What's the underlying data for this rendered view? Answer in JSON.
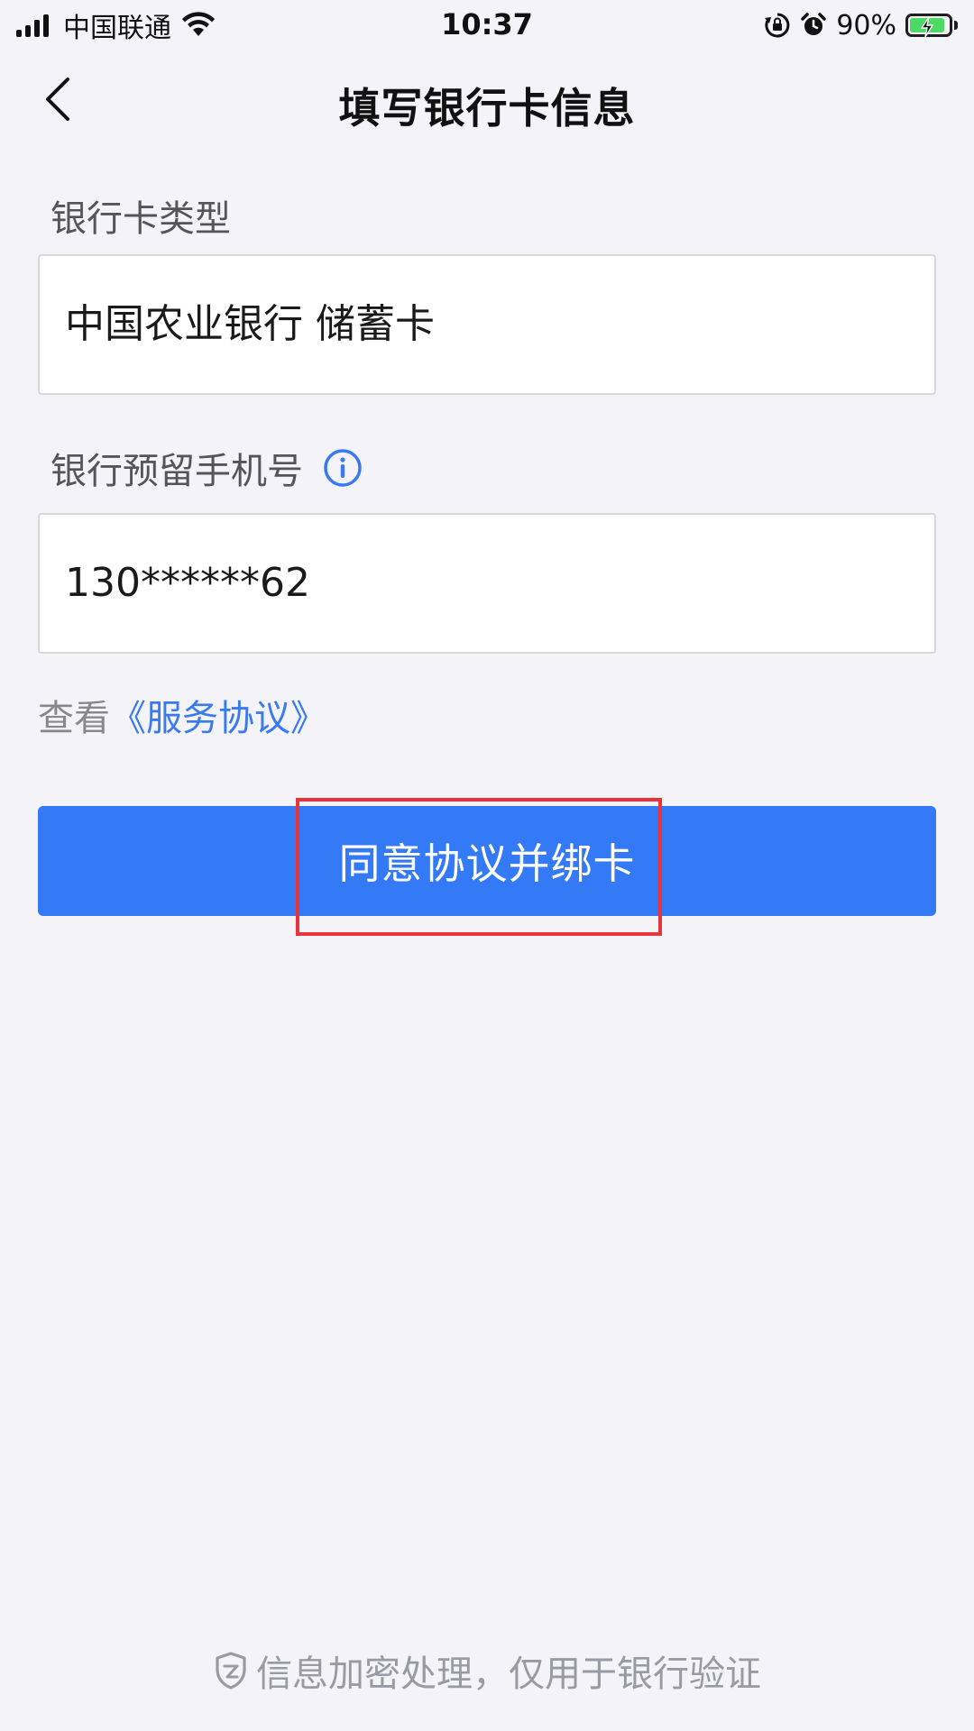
{
  "status_bar": {
    "carrier": "中国联通",
    "time": "10:37",
    "battery_percent": "90%",
    "battery_level": 0.9,
    "icons": [
      "signal-icon",
      "wifi-icon",
      "rotation-lock-icon",
      "alarm-icon",
      "battery-charging-icon"
    ]
  },
  "nav": {
    "title": "填写银行卡信息",
    "back_icon": "chevron-left-icon"
  },
  "form": {
    "card_type_label": "银行卡类型",
    "card_type_value": "中国农业银行 储蓄卡",
    "phone_label": "银行预留手机号",
    "phone_info_icon": "info-icon",
    "phone_value": "130******62"
  },
  "agreement": {
    "prefix": "查看",
    "link": "《服务协议》"
  },
  "submit_label": "同意协议并绑卡",
  "footer": {
    "icon": "shield-icon",
    "text": "信息加密处理，仅用于银行验证"
  },
  "colors": {
    "background": "#f3f3f8",
    "primary": "#3479f6",
    "link": "#3a7af1",
    "highlight": "#e8343a",
    "battery": "#4cd964"
  }
}
